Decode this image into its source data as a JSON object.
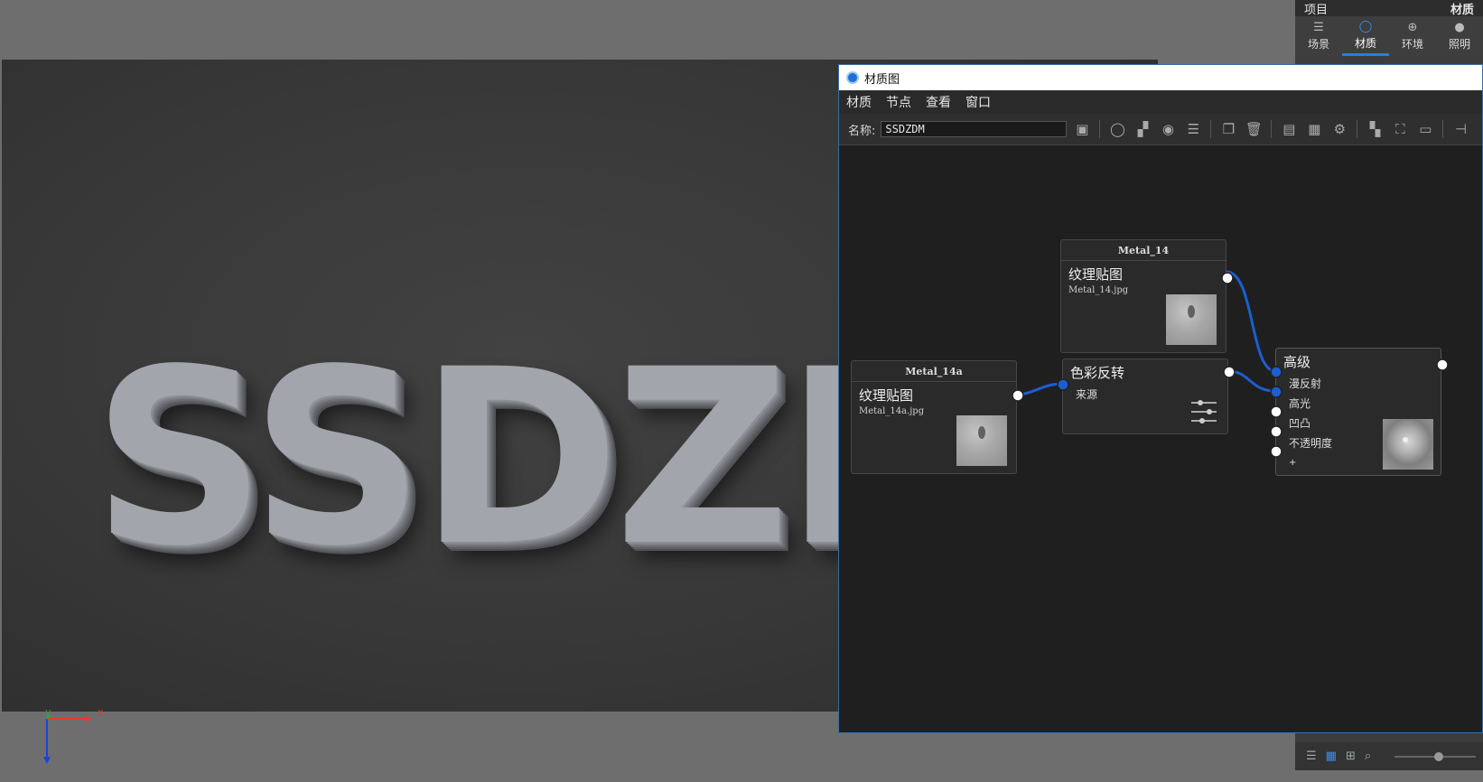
{
  "viewport": {
    "text": "SSDZD",
    "axis": {
      "x": "x",
      "y": "y"
    }
  },
  "right_panel": {
    "title_left": "项目",
    "title_right": "材质",
    "tabs": [
      {
        "label": "场景",
        "icon": "list-icon"
      },
      {
        "label": "材质",
        "icon": "material-icon",
        "active": true
      },
      {
        "label": "环境",
        "icon": "globe-icon"
      },
      {
        "label": "照明",
        "icon": "bulb-icon"
      }
    ]
  },
  "material_window": {
    "title": "材质图",
    "menu": [
      "材质",
      "节点",
      "查看",
      "窗口"
    ],
    "toolbar": {
      "name_label": "名称:",
      "name_value": "SSDZDM"
    },
    "nodes": {
      "texture2": {
        "header": "Metal_14",
        "title": "纹理贴图",
        "file": "Metal_14.jpg"
      },
      "texture1": {
        "header": "Metal_14a",
        "title": "纹理贴图",
        "file": "Metal_14a.jpg"
      },
      "invert": {
        "title": "色彩反转",
        "input": "来源"
      },
      "advanced": {
        "title": "高级",
        "inputs": [
          "漫反射",
          "高光",
          "凹凸",
          "不透明度",
          "+"
        ]
      }
    }
  },
  "colors": {
    "accent": "#2b7be4",
    "wire": "#1a5fd0"
  }
}
